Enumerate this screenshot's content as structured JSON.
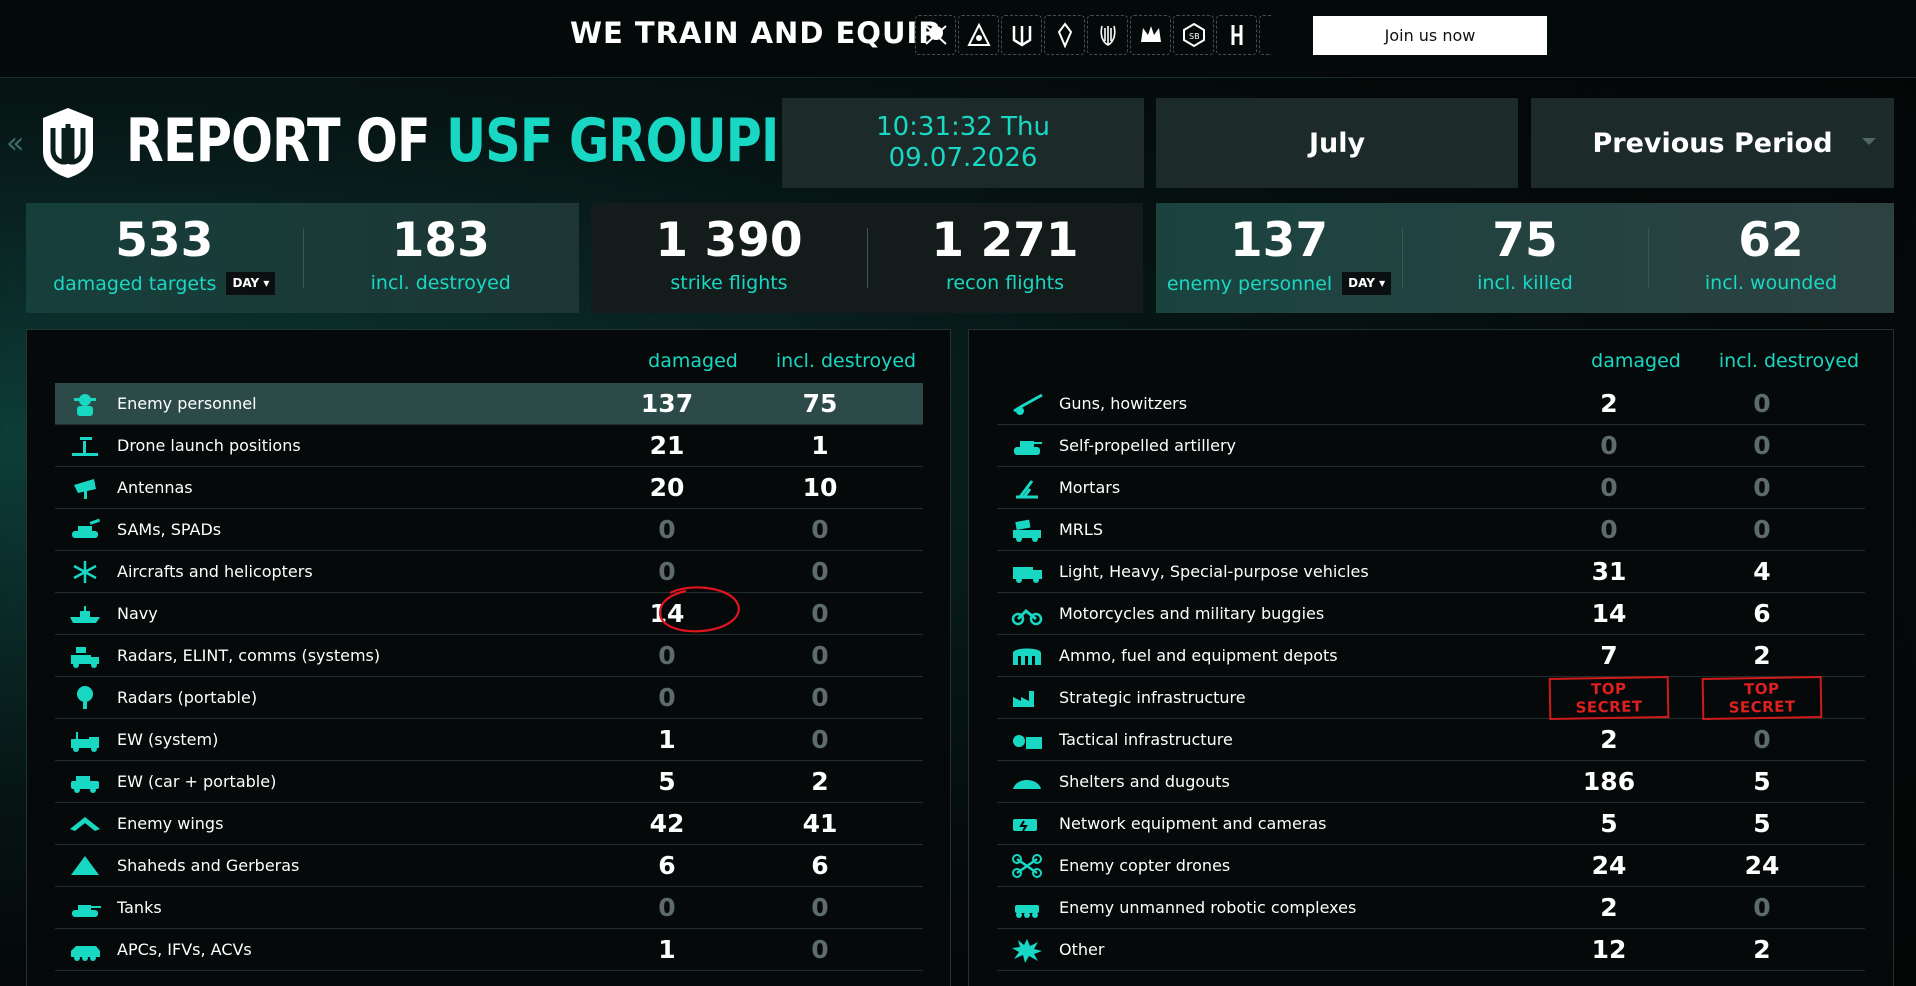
{
  "topbar": {
    "title": "WE TRAIN AND EQUIP",
    "join_label": "Join us now",
    "unit_icons": [
      "skull-icon",
      "pyramid-icon",
      "trident-icon",
      "blade-icon",
      "claw-icon",
      "crown-icon",
      "cube-icon",
      "bolt-icon",
      "partial-icon"
    ]
  },
  "header": {
    "title_main": "REPORT OF ",
    "title_accent": "USF GROUPING",
    "time": "10:31:32 Thu",
    "date": "09.07.2026",
    "month": "July",
    "period": "Previous Period"
  },
  "stats": {
    "damaged_targets": {
      "value": "533",
      "label": "damaged targets",
      "day": "DAY ▾"
    },
    "incl_destroyed": {
      "value": "183",
      "label": "incl. destroyed"
    },
    "strike_flights": {
      "value": "1 390",
      "label": "strike flights"
    },
    "recon_flights": {
      "value": "1 271",
      "label": "recon flights"
    },
    "enemy_personnel": {
      "value": "137",
      "label": "enemy personnel",
      "day": "DAY ▾"
    },
    "incl_killed": {
      "value": "75",
      "label": "incl. killed"
    },
    "incl_wounded": {
      "value": "62",
      "label": "incl. wounded"
    }
  },
  "left_table": {
    "col_damaged": "damaged",
    "col_destroyed": "incl. destroyed",
    "rows": [
      {
        "name": "Enemy personnel",
        "damaged": "137",
        "destroyed": "75",
        "icon": "soldier-icon"
      },
      {
        "name": "Drone launch positions",
        "damaged": "21",
        "destroyed": "1",
        "icon": "launch-pad-icon"
      },
      {
        "name": "Antennas",
        "damaged": "20",
        "destroyed": "10",
        "icon": "antenna-icon"
      },
      {
        "name": "SAMs, SPADs",
        "damaged": "0",
        "destroyed": "0",
        "icon": "sam-icon"
      },
      {
        "name": "Aircrafts and helicopters",
        "damaged": "0",
        "destroyed": "0",
        "icon": "helicopter-icon"
      },
      {
        "name": "Navy",
        "damaged": "14",
        "destroyed": "0",
        "icon": "ship-icon"
      },
      {
        "name": "Radars, ELINT, comms (systems)",
        "damaged": "0",
        "destroyed": "0",
        "icon": "radar-truck-icon"
      },
      {
        "name": "Radars (portable)",
        "damaged": "0",
        "destroyed": "0",
        "icon": "portable-radar-icon"
      },
      {
        "name": "EW (system)",
        "damaged": "1",
        "destroyed": "0",
        "icon": "ew-truck-icon"
      },
      {
        "name": "EW (car + portable)",
        "damaged": "5",
        "destroyed": "2",
        "icon": "ew-car-icon"
      },
      {
        "name": "Enemy wings",
        "damaged": "42",
        "destroyed": "41",
        "icon": "wing-icon"
      },
      {
        "name": "Shaheds and Gerberas",
        "damaged": "6",
        "destroyed": "6",
        "icon": "shahed-icon"
      },
      {
        "name": "Tanks",
        "damaged": "0",
        "destroyed": "0",
        "icon": "tank-icon"
      },
      {
        "name": "APCs, IFVs, ACVs",
        "damaged": "1",
        "destroyed": "0",
        "icon": "apc-icon"
      }
    ]
  },
  "right_table": {
    "col_damaged": "damaged",
    "col_destroyed": "incl. destroyed",
    "rows": [
      {
        "name": "Guns, howitzers",
        "damaged": "2",
        "destroyed": "0",
        "icon": "howitzer-icon"
      },
      {
        "name": "Self-propelled artillery",
        "damaged": "0",
        "destroyed": "0",
        "icon": "spg-icon"
      },
      {
        "name": "Mortars",
        "damaged": "0",
        "destroyed": "0",
        "icon": "mortar-icon"
      },
      {
        "name": "MRLS",
        "damaged": "0",
        "destroyed": "0",
        "icon": "mrls-icon"
      },
      {
        "name": "Light, Heavy, Special-purpose vehicles",
        "damaged": "31",
        "destroyed": "4",
        "icon": "truck-icon"
      },
      {
        "name": "Motorcycles and military buggies",
        "damaged": "14",
        "destroyed": "6",
        "icon": "motorcycle-icon"
      },
      {
        "name": "Ammo, fuel and equipment depots",
        "damaged": "7",
        "destroyed": "2",
        "icon": "depot-icon"
      },
      {
        "name": "Strategic infrastructure",
        "damaged": "TOP SECRET",
        "destroyed": "TOP SECRET",
        "icon": "factory-icon"
      },
      {
        "name": "Tactical infrastructure",
        "damaged": "2",
        "destroyed": "0",
        "icon": "tactical-infra-icon"
      },
      {
        "name": "Shelters and dugouts",
        "damaged": "186",
        "destroyed": "5",
        "icon": "shelter-icon"
      },
      {
        "name": "Network equipment and cameras",
        "damaged": "5",
        "destroyed": "5",
        "icon": "network-icon"
      },
      {
        "name": "Enemy copter drones",
        "damaged": "24",
        "destroyed": "24",
        "icon": "drone-icon"
      },
      {
        "name": "Enemy unmanned robotic complexes",
        "damaged": "2",
        "destroyed": "0",
        "icon": "robot-icon"
      },
      {
        "name": "Other",
        "damaged": "12",
        "destroyed": "2",
        "icon": "explosion-icon"
      }
    ]
  },
  "colors": {
    "accent": "#19d8c3",
    "zero": "#5d6b6a",
    "secret": "#e01f1f",
    "annotation": "#e0141e"
  }
}
